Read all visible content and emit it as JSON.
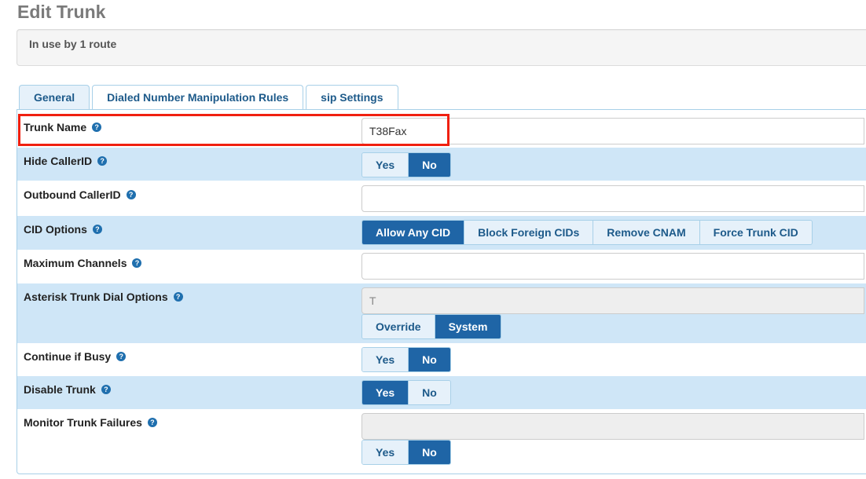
{
  "page_title": "Edit Trunk",
  "usage_note": "In use by 1 route",
  "tabs": [
    {
      "label": "General",
      "active": true
    },
    {
      "label": "Dialed Number Manipulation Rules",
      "active": false
    },
    {
      "label": "sip Settings",
      "active": false
    }
  ],
  "help_glyph": "?",
  "fields": {
    "trunk_name": {
      "label": "Trunk Name",
      "value": "T38Fax"
    },
    "hide_callerid": {
      "label": "Hide CallerID",
      "options": [
        "Yes",
        "No"
      ],
      "selected": "No"
    },
    "outbound_callerid": {
      "label": "Outbound CallerID",
      "value": ""
    },
    "cid_options": {
      "label": "CID Options",
      "options": [
        "Allow Any CID",
        "Block Foreign CIDs",
        "Remove CNAM",
        "Force Trunk CID"
      ],
      "selected": "Allow Any CID"
    },
    "max_channels": {
      "label": "Maximum Channels",
      "value": ""
    },
    "dial_options": {
      "label": "Asterisk Trunk Dial Options",
      "value": "T",
      "options": [
        "Override",
        "System"
      ],
      "selected": "System"
    },
    "continue_if_busy": {
      "label": "Continue if Busy",
      "options": [
        "Yes",
        "No"
      ],
      "selected": "No"
    },
    "disable_trunk": {
      "label": "Disable Trunk",
      "options": [
        "Yes",
        "No"
      ],
      "selected": "Yes"
    },
    "monitor_failures": {
      "label": "Monitor Trunk Failures",
      "value": "",
      "options": [
        "Yes",
        "No"
      ],
      "selected": "No"
    }
  },
  "colors": {
    "accent": "#1f65a6",
    "row_alt": "#cfe6f7",
    "highlight": "#f02010",
    "title": "#7a7a7a"
  }
}
